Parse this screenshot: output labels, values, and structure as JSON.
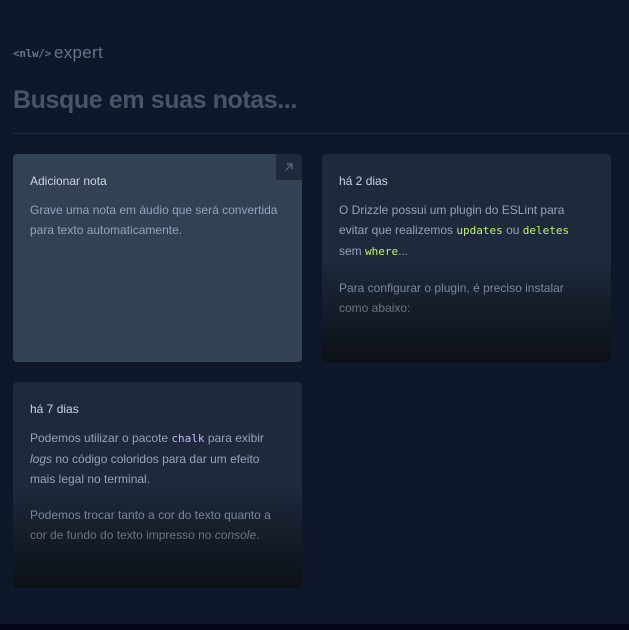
{
  "logo": {
    "tag": "<nlw/>",
    "word": "expert"
  },
  "search": {
    "placeholder": "Busque em suas notas..."
  },
  "add_note": {
    "title": "Adicionar nota",
    "description": "Grave uma nota em áudio que será convertida para texto automaticamente.",
    "corner_icon": "arrow-up-right-icon"
  },
  "notes": [
    {
      "date": "há 2 dias",
      "p1_a": "O Drizzle possui um plugin do ESLint para evitar que realizemos ",
      "p1_code1": "updates",
      "p1_b": " ou ",
      "p1_code2": "deletes",
      "p1_c": " sem ",
      "p1_code3": "where",
      "p1_d": "...",
      "p2": "Para configurar o plugin, é preciso instalar como abaixo:"
    },
    {
      "date": "há 7 dias",
      "p1_a": "Podemos utilizar o pacote ",
      "p1_code1": "chalk",
      "p1_b": " para exibir ",
      "p1_em1": "logs",
      "p1_c": " no código coloridos para dar um efeito mais legal no terminal.",
      "p2_a": "Podemos trocar tanto a cor do texto quanto a cor de fundo do texto impresso no ",
      "p2_em1": "console",
      "p2_b": "."
    }
  ],
  "colors": {
    "background": "#0f172a",
    "card_add": "#334155",
    "card_note": "#1e293b",
    "code_lime": "#bef264",
    "code_violet": "#c4b5fd"
  }
}
